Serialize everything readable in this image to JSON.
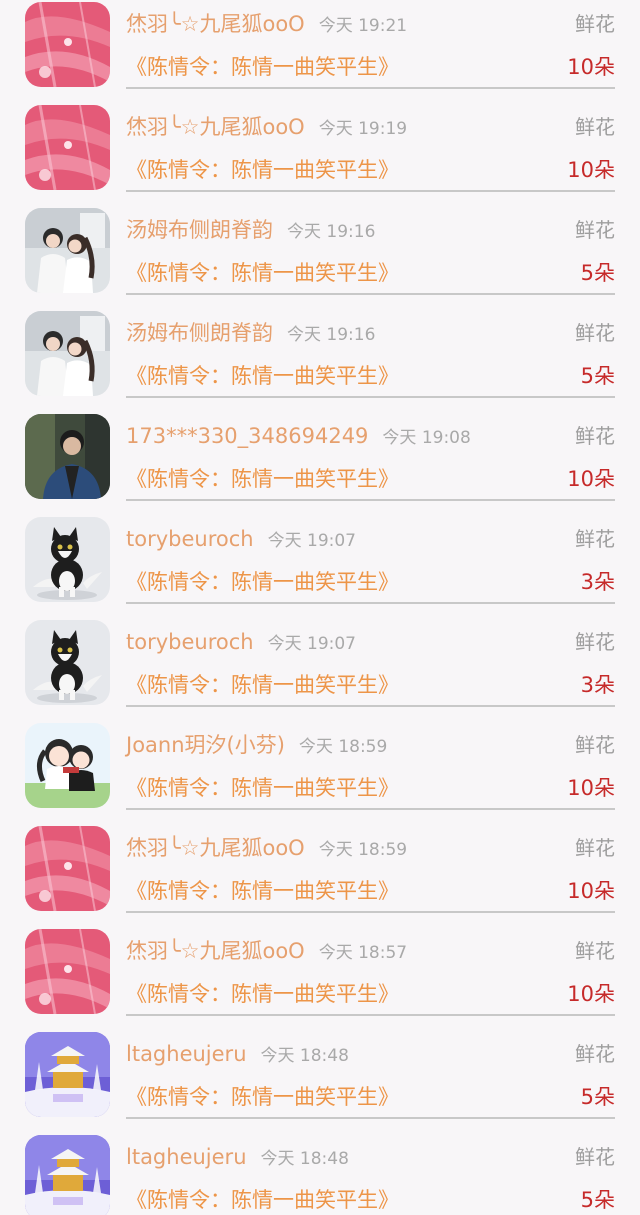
{
  "items": [
    {
      "name": "烋羽╰☆九尾狐ooO",
      "time": "今天 19:21",
      "gift": "鲜花",
      "book": "《陈情令：陈情一曲笑平生》",
      "count": "10朵",
      "avatar": "pink-feather"
    },
    {
      "name": "烋羽╰☆九尾狐ooO",
      "time": "今天 19:19",
      "gift": "鲜花",
      "book": "《陈情令：陈情一曲笑平生》",
      "count": "10朵",
      "avatar": "pink-feather"
    },
    {
      "name": "汤姆布侧朗脊韵",
      "time": "今天 19:16",
      "gift": "鲜花",
      "book": "《陈情令：陈情一曲笑平生》",
      "count": "5朵",
      "avatar": "couple-photo"
    },
    {
      "name": "汤姆布侧朗脊韵",
      "time": "今天 19:16",
      "gift": "鲜花",
      "book": "《陈情令：陈情一曲笑平生》",
      "count": "5朵",
      "avatar": "couple-photo"
    },
    {
      "name": "173***330_348694249",
      "time": "今天 19:08",
      "gift": "鲜花",
      "book": "《陈情令：陈情一曲笑平生》",
      "count": "10朵",
      "avatar": "man-portrait"
    },
    {
      "name": "torybeuroch",
      "time": "今天 19:07",
      "gift": "鲜花",
      "book": "《陈情令：陈情一曲笑平生》",
      "count": "3朵",
      "avatar": "kitten"
    },
    {
      "name": "torybeuroch",
      "time": "今天 19:07",
      "gift": "鲜花",
      "book": "《陈情令：陈情一曲笑平生》",
      "count": "3朵",
      "avatar": "kitten"
    },
    {
      "name": "Joann玥汐(小芬)",
      "time": "今天 18:59",
      "gift": "鲜花",
      "book": "《陈情令：陈情一曲笑平生》",
      "count": "10朵",
      "avatar": "chibi-pair"
    },
    {
      "name": "烋羽╰☆九尾狐ooO",
      "time": "今天 18:59",
      "gift": "鲜花",
      "book": "《陈情令：陈情一曲笑平生》",
      "count": "10朵",
      "avatar": "pink-feather"
    },
    {
      "name": "烋羽╰☆九尾狐ooO",
      "time": "今天 18:57",
      "gift": "鲜花",
      "book": "《陈情令：陈情一曲笑平生》",
      "count": "10朵",
      "avatar": "pink-feather"
    },
    {
      "name": "ltagheujeru",
      "time": "今天 18:48",
      "gift": "鲜花",
      "book": "《陈情令：陈情一曲笑平生》",
      "count": "5朵",
      "avatar": "snow-temple"
    },
    {
      "name": "ltagheujeru",
      "time": "今天 18:48",
      "gift": "鲜花",
      "book": "《陈情令：陈情一曲笑平生》",
      "count": "5朵",
      "avatar": "snow-temple"
    }
  ]
}
